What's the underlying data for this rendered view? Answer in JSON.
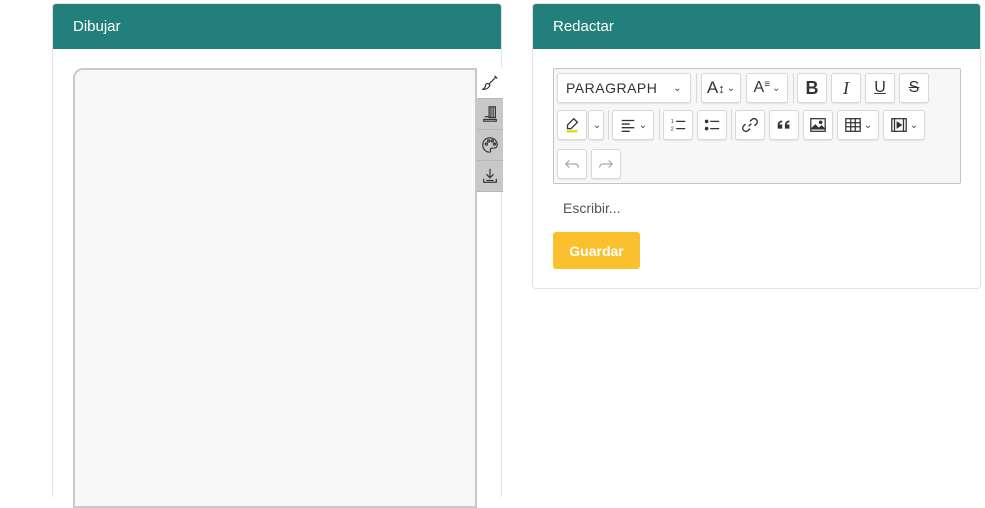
{
  "draw_panel": {
    "title": "Dibujar",
    "tools": [
      {
        "icon": "brush-icon"
      },
      {
        "icon": "sharpen-icon"
      },
      {
        "icon": "palette-icon"
      },
      {
        "icon": "download-icon"
      }
    ]
  },
  "write_panel": {
    "title": "Redactar",
    "toolbar": {
      "paragraph_label": "PARAGRAPH",
      "bold": "B",
      "italic": "I",
      "underline": "U",
      "strike": "S",
      "font_size_label": "A",
      "format_label": "A"
    },
    "editor_placeholder": "Escribir...",
    "save_label": "Guardar"
  },
  "colors": {
    "header": "#237f7c",
    "save_button": "#fbc02d",
    "highlight_bar": "#e6d600"
  }
}
